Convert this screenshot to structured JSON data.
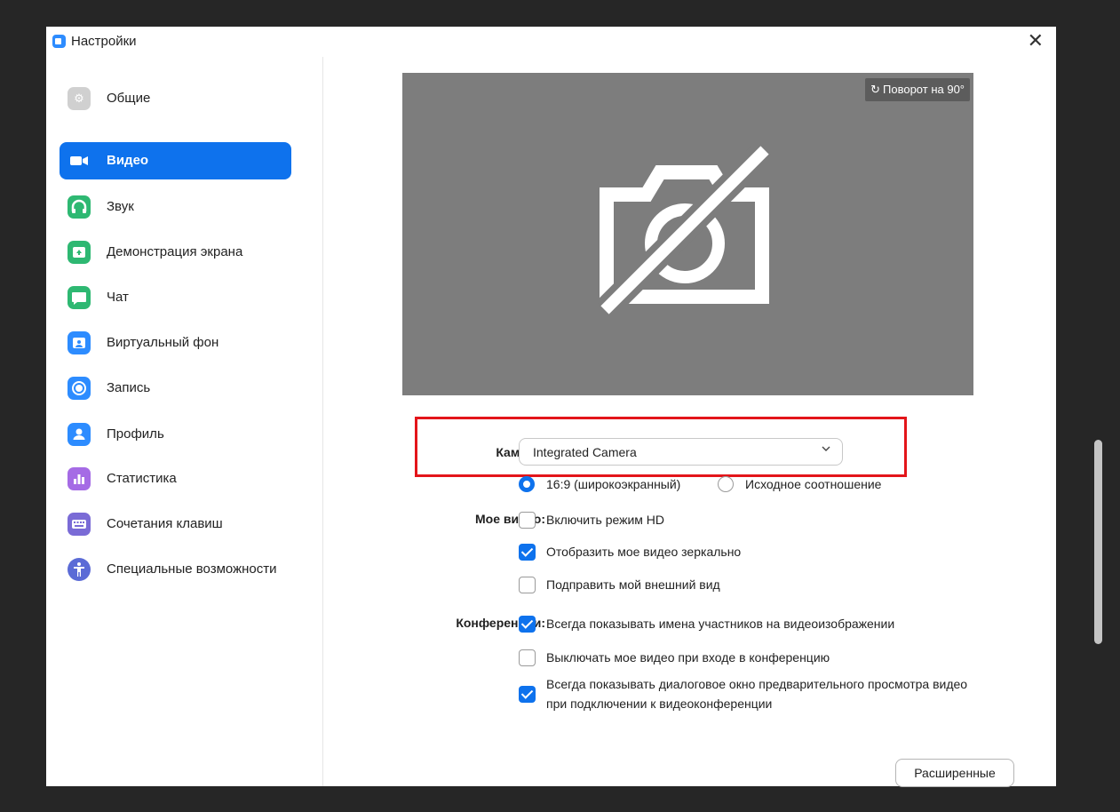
{
  "window": {
    "title": "Настройки",
    "close_glyph": "✕"
  },
  "sidebar": {
    "items": [
      {
        "label": "Общие",
        "icon": "gear-icon",
        "color": "#d0d0d0",
        "glyph": "⚙"
      },
      {
        "label": "Видео",
        "icon": "video-camera-icon",
        "color": "#0e72ed",
        "glyph": "■"
      },
      {
        "label": "Звук",
        "icon": "headphones-icon",
        "color": "#2eb872",
        "glyph": "∩"
      },
      {
        "label": "Демонстрация экрана",
        "icon": "share-screen-icon",
        "color": "#2eb872",
        "glyph": "↑"
      },
      {
        "label": "Чат",
        "icon": "chat-bubble-icon",
        "color": "#2eb872",
        "glyph": "▪"
      },
      {
        "label": "Виртуальный фон",
        "icon": "virtual-background-icon",
        "color": "#2d8cff",
        "glyph": "▣"
      },
      {
        "label": "Запись",
        "icon": "record-icon",
        "color": "#2d8cff",
        "glyph": "◉"
      },
      {
        "label": "Профиль",
        "icon": "profile-icon",
        "color": "#2d8cff",
        "glyph": "●"
      },
      {
        "label": "Статистика",
        "icon": "statistics-icon",
        "color": "#a56be5",
        "glyph": "▥"
      },
      {
        "label": "Сочетания клавиш",
        "icon": "keyboard-icon",
        "color": "#7a6bd6",
        "glyph": "▦"
      },
      {
        "label": "Специальные возможности",
        "icon": "accessibility-icon",
        "color": "#5b6bd6",
        "glyph": "☨"
      }
    ],
    "active_index": 1
  },
  "preview": {
    "rotate_label": "Поворот на 90°",
    "rotate_icon": "rotate-icon"
  },
  "camera": {
    "label": "Камера:",
    "selected": "Integrated Camera"
  },
  "aspect": {
    "options": [
      {
        "label": "16:9 (широкоэкранный)",
        "selected": true
      },
      {
        "label": "Исходное соотношение",
        "selected": false
      }
    ]
  },
  "my_video": {
    "label": "Мое видео:",
    "options": [
      {
        "label": "Включить режим HD",
        "checked": false
      },
      {
        "label": "Отобразить мое видео зеркально",
        "checked": true
      },
      {
        "label": "Подправить мой внешний вид",
        "checked": false
      }
    ]
  },
  "meetings": {
    "label": "Конференции:",
    "options": [
      {
        "label": "Всегда показывать имена участников на видеоизображении",
        "checked": true
      },
      {
        "label": "Выключать мое видео при входе в конференцию",
        "checked": false
      },
      {
        "label": "Всегда показывать диалоговое окно предварительного просмотра видео",
        "label2": "при подключении к видеоконференции",
        "checked": true
      }
    ]
  },
  "advanced_label": "Расширенные",
  "colors": {
    "accent": "#0e72ed",
    "highlight": "#e3151a",
    "preview_bg": "#7d7d7d"
  }
}
